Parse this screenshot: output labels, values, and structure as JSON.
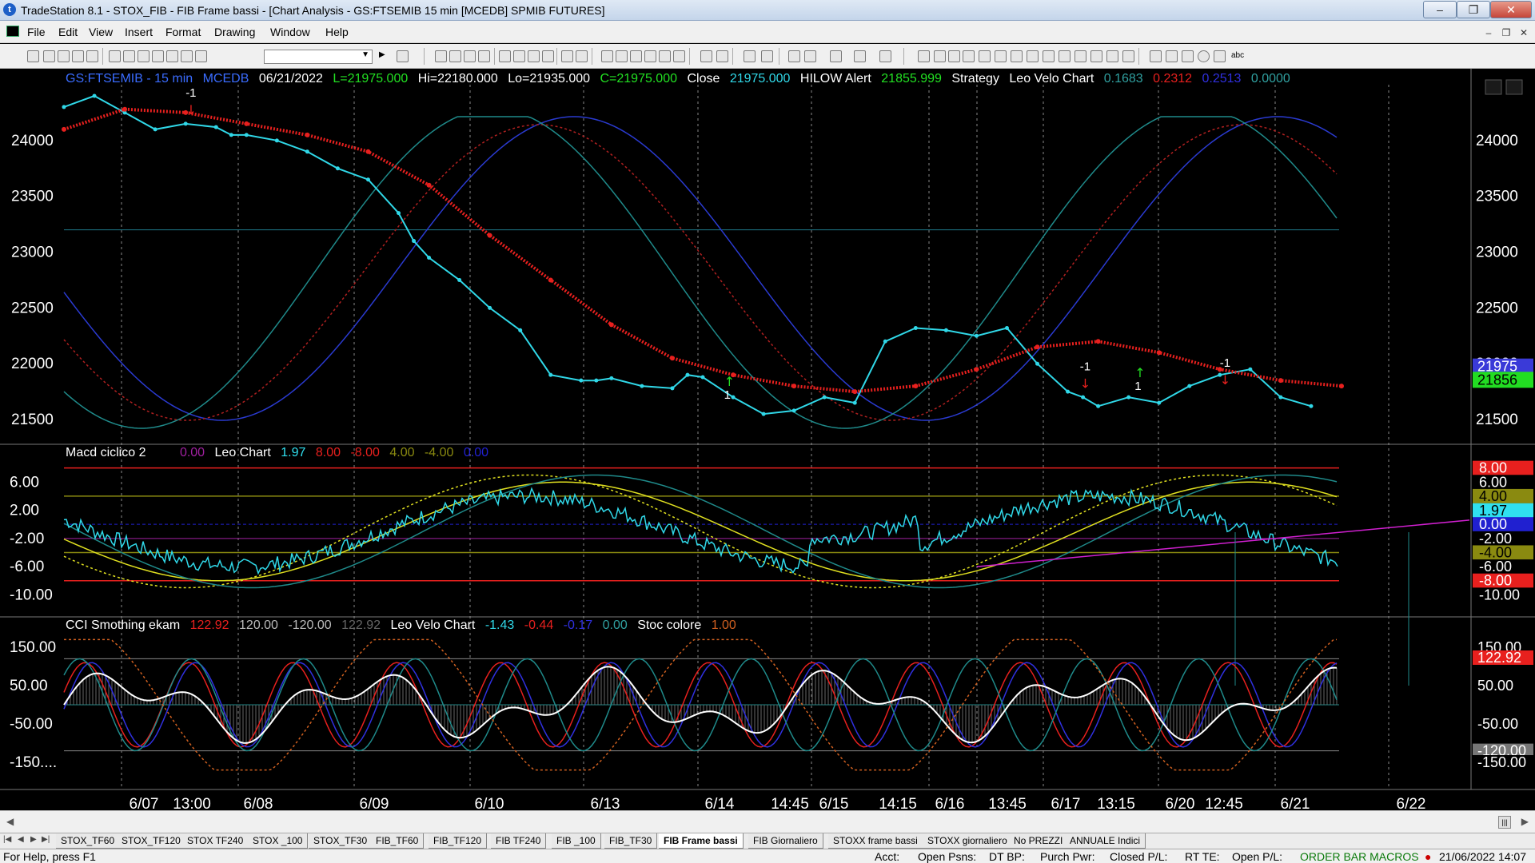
{
  "window": {
    "title": "TradeStation 8.1 - STOX_FIB - FIB Frame bassi - [Chart Analysis - GS:FTSEMIB  15 min  [MCEDB] SPMIB FUTURES]"
  },
  "menu": [
    "File",
    "Edit",
    "View",
    "Insert",
    "Format",
    "Drawing",
    "Window",
    "Help"
  ],
  "chart_data": [
    {
      "type": "line",
      "title": "GS:FTSEMIB - 15 min",
      "header": {
        "symbol": "GS:FTSEMIB - 15 min",
        "exchange": "MCEDB",
        "date": "06/21/2022",
        "last": "L=21975.000",
        "high": "Hi=22180.000",
        "low": "Lo=21935.000",
        "close": "C=21975.000",
        "close_label": "Close",
        "close_value": "21975.000",
        "hilow_label": "HILOW Alert",
        "hilow_value": "21855.999",
        "strategy_label": "Strategy",
        "leo_label": "Leo Velo Chart",
        "v1": "0.1683",
        "v2": "0.2312",
        "v3": "0.2513",
        "v4": "0.0000"
      },
      "y_ticks": [
        "24000",
        "23500",
        "23000",
        "22500",
        "22000",
        "21500"
      ],
      "ylim": [
        21350,
        24500
      ],
      "badges": [
        {
          "text": "21975",
          "color": "#3a3ad8"
        },
        {
          "text": "21856",
          "color": "#22dd22"
        }
      ],
      "signals": [
        "-1",
        "1",
        "-1",
        "1",
        "-1"
      ],
      "series": [
        {
          "name": "Close",
          "color": "#30d8e8",
          "x": [
            0,
            10,
            20,
            30,
            40,
            50,
            55,
            60,
            70,
            80,
            90,
            100,
            110,
            115,
            120,
            130,
            140,
            150,
            160,
            170,
            175,
            180,
            190,
            200,
            205,
            210,
            220,
            230,
            240,
            250,
            260,
            270,
            280,
            290,
            300,
            310,
            320,
            330,
            335,
            340,
            350,
            360,
            370,
            380,
            390,
            400,
            410
          ],
          "y": [
            24300,
            24400,
            24250,
            24100,
            24150,
            24120,
            24050,
            24050,
            24000,
            23900,
            23750,
            23650,
            23350,
            23100,
            22950,
            22750,
            22500,
            22300,
            21900,
            21850,
            21850,
            21870,
            21800,
            21780,
            21900,
            21880,
            21700,
            21550,
            21580,
            21700,
            21650,
            22200,
            22320,
            22300,
            22250,
            22320,
            22000,
            21750,
            21700,
            21620,
            21700,
            21650,
            21800,
            21900,
            21950,
            21700,
            21620
          ]
        },
        {
          "name": "HILOW Alert",
          "color": "#e8201e",
          "x": [
            0,
            20,
            40,
            60,
            80,
            100,
            120,
            140,
            160,
            180,
            200,
            220,
            240,
            260,
            280,
            300,
            320,
            340,
            360,
            380,
            400,
            420
          ],
          "y": [
            24100,
            24280,
            24250,
            24150,
            24050,
            23900,
            23600,
            23150,
            22750,
            22350,
            22050,
            21900,
            21800,
            21750,
            21800,
            21950,
            22150,
            22200,
            22100,
            21950,
            21850,
            21800
          ]
        }
      ]
    },
    {
      "type": "line",
      "title": "Macd ciclico 2",
      "header": {
        "label": "Macd ciclico 2",
        "v1": "0.00",
        "leo": "Leo Chart",
        "v2": "1.97",
        "v3": "8.00",
        "v4": "-8.00",
        "v5": "4.00",
        "v6": "-4.00",
        "v7": "0.00"
      },
      "y_ticks": [
        "6.00",
        "2.00",
        "-2.00",
        "-6.00",
        "-10.00"
      ],
      "ylim": [
        -12,
        10
      ],
      "badges": [
        {
          "text": "8.00",
          "color": "#e8201e"
        },
        {
          "text": "6.00",
          "color": "#000"
        },
        {
          "text": "4.00",
          "color": "#8a8a10"
        },
        {
          "text": "1.97",
          "color": "#30e0f0"
        },
        {
          "text": "0.00",
          "color": "#2020d0"
        },
        {
          "text": "-2.00",
          "color": "#000"
        },
        {
          "text": "-4.00",
          "color": "#8a8a10"
        },
        {
          "text": "-6.00",
          "color": "#000"
        },
        {
          "text": "-8.00",
          "color": "#e8201e"
        },
        {
          "text": "-10.00",
          "color": "#000"
        }
      ],
      "levels": [
        8,
        4,
        0,
        -4,
        -8
      ]
    },
    {
      "type": "line",
      "title": "CCI Smothing ekam",
      "header": {
        "label": "CCI Smothing ekam",
        "v1": "122.92",
        "v2": "120.00",
        "v3": "-120.00",
        "v4": "122.92",
        "leo": "Leo Velo Chart",
        "v5": "-1.43",
        "v6": "-0.44",
        "v7": "-0.17",
        "v8": "0.00",
        "stoc": "Stoc colore",
        "v9": "1.00"
      },
      "y_ticks": [
        "150.00",
        "50.00",
        "-50.00",
        "-150...."
      ],
      "ylim": [
        -200,
        200
      ],
      "badges": [
        {
          "text": "150.00",
          "color": "#000"
        },
        {
          "text": "122.92",
          "color": "#e8201e"
        },
        {
          "text": "50.00",
          "color": "#000"
        },
        {
          "text": "-50.00",
          "color": "#000"
        },
        {
          "text": "-120.00",
          "color": "#777"
        },
        {
          "text": "-150.00",
          "color": "#000"
        }
      ]
    }
  ],
  "x_labels": [
    "6/07",
    "13:00",
    "6/08",
    "6/09",
    "6/10",
    "6/13",
    "6/14",
    "14:45",
    "6/15",
    "14:15",
    "6/16",
    "13:45",
    "6/17",
    "13:15",
    "6/20",
    "12:45",
    "6/21",
    "6/22"
  ],
  "tabs": [
    "STOX_TF60",
    "STOX_TF120",
    "STOX TF240",
    "STOX _100",
    "STOX_TF30",
    "FIB_TF60",
    "FIB_TF120",
    "FIB TF240",
    "FIB _100",
    "FIB_TF30",
    "FIB Frame bassi",
    "FIB Giornaliero",
    "STOXX frame bassi",
    "STOXX giornaliero",
    "No PREZZI",
    "ANNUALE Indici"
  ],
  "active_tab": "FIB Frame bassi",
  "status": {
    "help": "For Help, press F1",
    "acct": "Acct:",
    "open_psns": "Open Psns:",
    "dt_bp": "DT BP:",
    "purch_pwr": "Purch Pwr:",
    "closed_pl": "Closed P/L:",
    "rt_te": "RT TE:",
    "open_pl": "Open P/L:",
    "order_bar": "ORDER BAR  MACROS",
    "datetime": "21/06/2022 14:07"
  }
}
